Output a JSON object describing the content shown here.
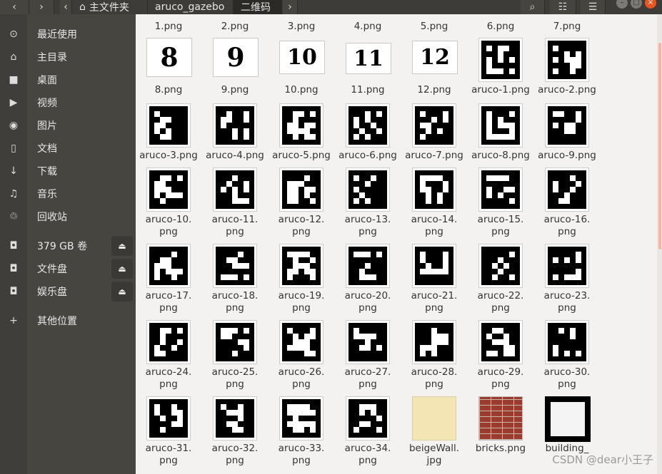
{
  "header": {
    "back_icon": "‹",
    "forward_icon": "›",
    "breadcrumb": [
      {
        "label": "主文件夹",
        "icon": "home-icon"
      },
      {
        "label": "aruco_gazebo"
      },
      {
        "label": "二维码",
        "active": true
      }
    ],
    "search_icon": "⌕",
    "view_icon": "☷",
    "menu_icon": "☰"
  },
  "sidebar": {
    "items": [
      {
        "icon": "⊙",
        "icon_name": "recent-icon",
        "label": "最近使用"
      },
      {
        "icon": "⌂",
        "icon_name": "home-icon",
        "label": "主目录"
      },
      {
        "icon": "■",
        "icon_name": "desktop-folder-icon",
        "label": "桌面"
      },
      {
        "icon": "▶",
        "icon_name": "video-icon",
        "label": "视频"
      },
      {
        "icon": "◉",
        "icon_name": "camera-icon",
        "label": "图片"
      },
      {
        "icon": "▯",
        "icon_name": "document-icon",
        "label": "文档"
      },
      {
        "icon": "↓",
        "icon_name": "download-icon",
        "label": "下载"
      },
      {
        "icon": "♫",
        "icon_name": "music-icon",
        "label": "音乐"
      },
      {
        "icon": "♲",
        "icon_name": "trash-icon",
        "label": "回收站"
      }
    ],
    "drives": [
      {
        "label": "379 GB 卷",
        "eject": "⏏"
      },
      {
        "label": "文件盘",
        "eject": "⏏"
      },
      {
        "label": "娱乐盘",
        "eject": "⏏"
      }
    ],
    "other": {
      "icon": "+",
      "label": "其他位置"
    }
  },
  "files": {
    "top_row": [
      "1.png",
      "2.png",
      "3.png",
      "4.png",
      "5.png",
      "6.png",
      "7.png"
    ],
    "items": [
      {
        "name": "8.png",
        "thumb": "number",
        "text": "8"
      },
      {
        "name": "9.png",
        "thumb": "number",
        "text": "9"
      },
      {
        "name": "10.png",
        "thumb": "number",
        "text": "10"
      },
      {
        "name": "11.png",
        "thumb": "number",
        "text": "11"
      },
      {
        "name": "12.png",
        "thumb": "number",
        "text": "12"
      },
      {
        "name": "aruco-1.png",
        "thumb": "marker"
      },
      {
        "name": "aruco-2.png",
        "thumb": "marker"
      },
      {
        "name": "aruco-3.png",
        "thumb": "marker"
      },
      {
        "name": "aruco-4.png",
        "thumb": "marker"
      },
      {
        "name": "aruco-5.png",
        "thumb": "marker"
      },
      {
        "name": "aruco-6.png",
        "thumb": "marker"
      },
      {
        "name": "aruco-7.png",
        "thumb": "marker"
      },
      {
        "name": "aruco-8.png",
        "thumb": "marker"
      },
      {
        "name": "aruco-9.png",
        "thumb": "marker"
      },
      {
        "name": "aruco-10.\npng",
        "thumb": "marker"
      },
      {
        "name": "aruco-11.\npng",
        "thumb": "marker"
      },
      {
        "name": "aruco-12.\npng",
        "thumb": "marker"
      },
      {
        "name": "aruco-13.\npng",
        "thumb": "marker"
      },
      {
        "name": "aruco-14.\npng",
        "thumb": "marker"
      },
      {
        "name": "aruco-15.\npng",
        "thumb": "marker"
      },
      {
        "name": "aruco-16.\npng",
        "thumb": "marker"
      },
      {
        "name": "aruco-17.\npng",
        "thumb": "marker"
      },
      {
        "name": "aruco-18.\npng",
        "thumb": "marker"
      },
      {
        "name": "aruco-19.\npng",
        "thumb": "marker"
      },
      {
        "name": "aruco-20.\npng",
        "thumb": "marker"
      },
      {
        "name": "aruco-21.\npng",
        "thumb": "marker"
      },
      {
        "name": "aruco-22.\npng",
        "thumb": "marker"
      },
      {
        "name": "aruco-23.\npng",
        "thumb": "marker"
      },
      {
        "name": "aruco-24.\npng",
        "thumb": "marker"
      },
      {
        "name": "aruco-25.\npng",
        "thumb": "marker"
      },
      {
        "name": "aruco-26.\npng",
        "thumb": "marker"
      },
      {
        "name": "aruco-27.\npng",
        "thumb": "marker"
      },
      {
        "name": "aruco-28.\npng",
        "thumb": "marker"
      },
      {
        "name": "aruco-29.\npng",
        "thumb": "marker"
      },
      {
        "name": "aruco-30.\npng",
        "thumb": "marker"
      },
      {
        "name": "aruco-31.\npng",
        "thumb": "marker"
      },
      {
        "name": "aruco-32.\npng",
        "thumb": "marker"
      },
      {
        "name": "aruco-33.\npng",
        "thumb": "marker"
      },
      {
        "name": "aruco-34.\npng",
        "thumb": "marker"
      },
      {
        "name": "beigeWall.\njpg",
        "thumb": "beige"
      },
      {
        "name": "bricks.png",
        "thumb": "bricks"
      },
      {
        "name": "building_",
        "thumb": "building"
      }
    ]
  },
  "watermark": "CSDN @dear小王子",
  "colors": {
    "header_bg": "#3d3c38",
    "sidebar_bg": "#464540",
    "content_bg": "#f3f2f1",
    "accent": "#e95420",
    "beige": "#f4e6b4",
    "brick": "#9b3b30"
  }
}
